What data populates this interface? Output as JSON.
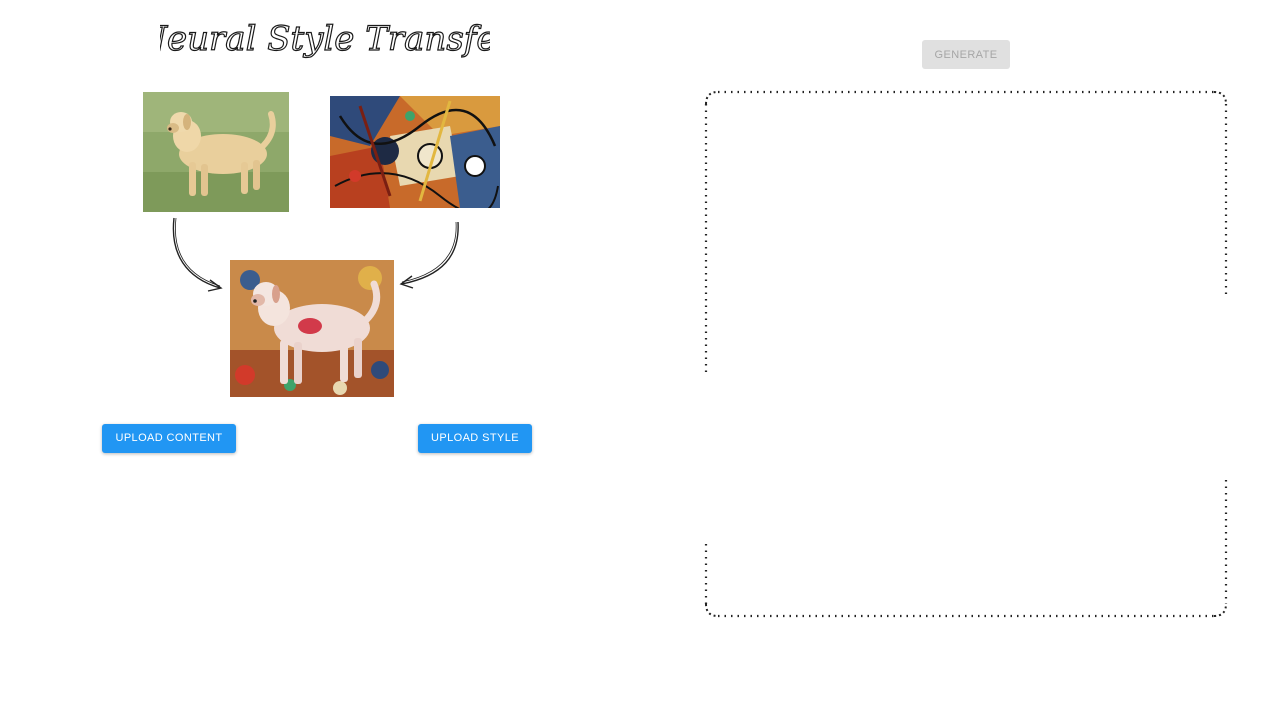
{
  "title": "Neural Style Transfer",
  "images": {
    "content": "content-image-dog",
    "style": "style-image-abstract-painting",
    "result": "stylized-result-image"
  },
  "buttons": {
    "upload_content": "UPLOAD CONTENT",
    "upload_style": "UPLOAD STYLE",
    "generate": "GENERATE"
  },
  "colors": {
    "primary_button": "#2196f3",
    "disabled_button": "#e0e0e0",
    "disabled_text": "#a6a6a6"
  }
}
